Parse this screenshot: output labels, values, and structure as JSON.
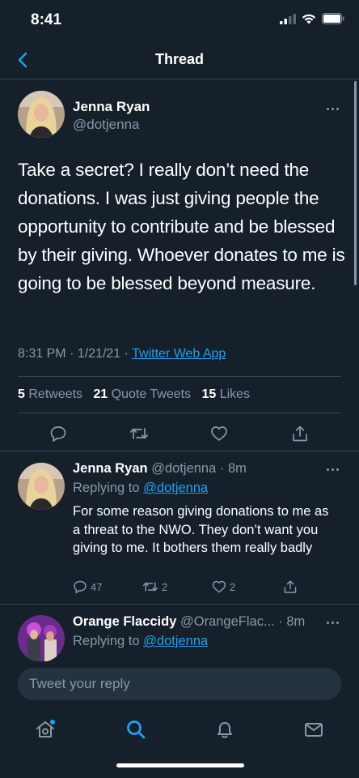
{
  "status_bar": {
    "time": "8:41"
  },
  "nav": {
    "title": "Thread"
  },
  "main_tweet": {
    "author_name": "Jenna Ryan",
    "author_handle": "@dotjenna",
    "text": "Take a secret? I really don’t need the donations. I was just giving people the opportunity to contribute and be blessed by their giving. Whoever donates to me is going to be blessed beyond measure.",
    "timestamp": "8:31 PM · 1/21/21 · ",
    "source": "Twitter Web App",
    "retweets_count": "5",
    "retweets_label": "Retweets",
    "quote_count": "21",
    "quote_label": "Quote Tweets",
    "likes_count": "15",
    "likes_label": "Likes"
  },
  "replies": [
    {
      "name": "Jenna Ryan",
      "handle_time": "@dotjenna · 8m",
      "replying_prefix": "Replying to ",
      "replying_to": "@dotjenna",
      "text": "For some reason giving donations to me as a threat to the NWO. They don’t want you giving to me. It bothers them really badly",
      "reply_count": "47",
      "retweet_count": "2",
      "like_count": "2"
    },
    {
      "name": "Orange Flaccidy",
      "handle_time": "@OrangeFlac... · 8m",
      "replying_prefix": "Replying to ",
      "replying_to": "@dotjenna"
    }
  ],
  "compose": {
    "placeholder": "Tweet your reply"
  },
  "tab_bar": {
    "items": [
      "home-icon",
      "search-icon",
      "notifications-icon",
      "messages-icon"
    ]
  },
  "colors": {
    "background": "#15202b",
    "accent": "#1da1f2",
    "secondary_text": "#8899a6",
    "divider": "#38444d"
  }
}
